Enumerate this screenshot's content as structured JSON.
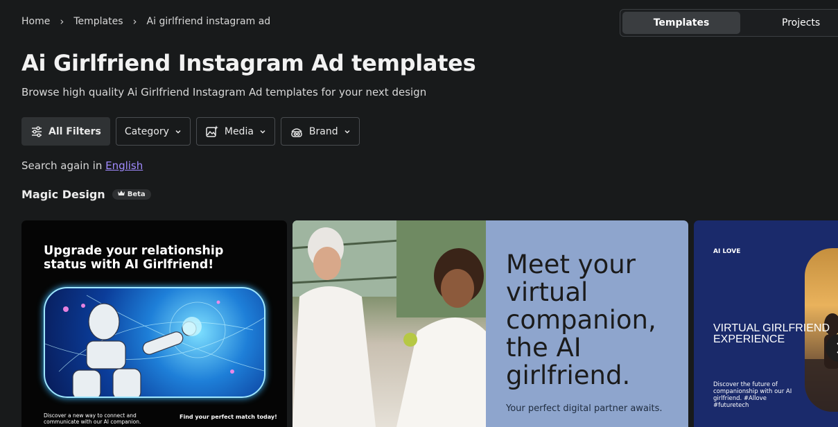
{
  "breadcrumb": {
    "home": "Home",
    "templates": "Templates",
    "current": "Ai girlfriend instagram ad"
  },
  "tabs": {
    "templates": "Templates",
    "projects": "Projects"
  },
  "page": {
    "title": "Ai Girlfriend Instagram Ad templates",
    "subtitle": "Browse high quality Ai Girlfriend Instagram Ad templates for your next design"
  },
  "filters": {
    "all_filters": "All Filters",
    "category": "Category",
    "media": "Media",
    "brand": "Brand"
  },
  "search_again": {
    "prefix": "Search again in ",
    "language": "English"
  },
  "magic_design": {
    "title": "Magic Design",
    "badge": "Beta"
  },
  "cards": [
    {
      "headline": "Upgrade your relationship status with AI Girlfriend!",
      "footer_left": "Discover a new way to connect and communicate with our AI companion.",
      "footer_right": "Find your perfect match today!"
    },
    {
      "headline": "Meet your virtual companion, the AI girlfriend.",
      "subline": "Your perfect digital partner awaits."
    },
    {
      "label": "AI LOVE",
      "headline": "VIRTUAL GIRLFRIEND EXPERIENCE",
      "body": "Discover the future of companionship with our AI girlfriend. #Allove #futuretech"
    }
  ],
  "colors": {
    "background": "#181a1b",
    "link": "#a18bff",
    "card2_bg": "#8ea5cd",
    "card3_bg": "#1a2a6b"
  }
}
